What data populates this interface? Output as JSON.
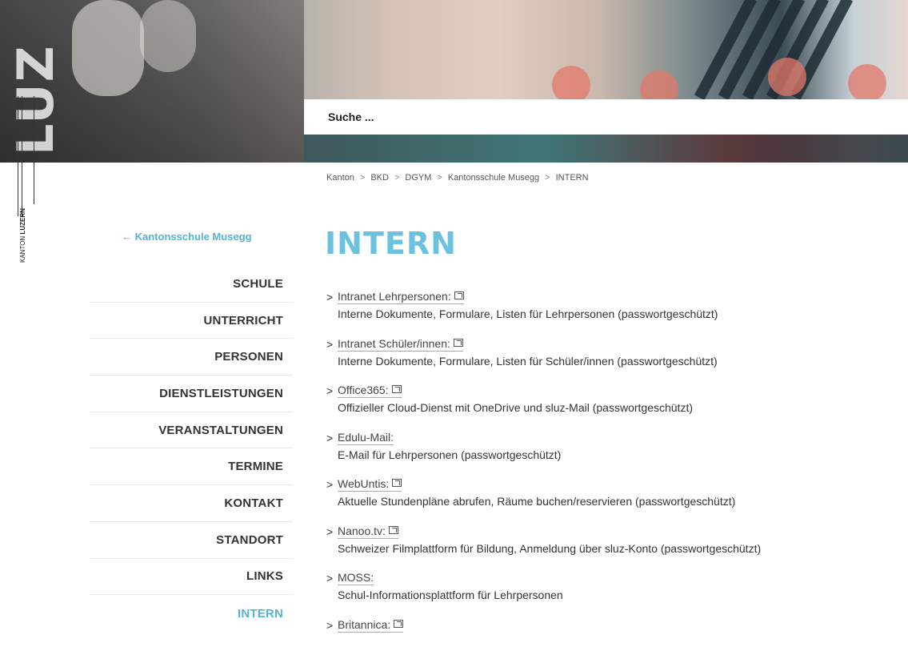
{
  "header": {
    "brand_vertical": "LUZ",
    "search_placeholder": "Suche ..."
  },
  "logo": {
    "line1": "KANTON",
    "line2": "LUZERN"
  },
  "breadcrumb": [
    "Kanton",
    "BKD",
    "DGYM",
    "Kantonsschule Musegg",
    "INTERN"
  ],
  "sidebar": {
    "back_label": "← Kantonsschule Musegg",
    "items": [
      {
        "label": "SCHULE"
      },
      {
        "label": "UNTERRICHT"
      },
      {
        "label": "PERSONEN"
      },
      {
        "label": "DIENSTLEISTUNGEN"
      },
      {
        "label": "VERANSTALTUNGEN"
      },
      {
        "label": "TERMINE"
      },
      {
        "label": "KONTAKT"
      },
      {
        "label": "STANDORT"
      },
      {
        "label": "LINKS"
      },
      {
        "label": "INTERN",
        "active": true
      }
    ]
  },
  "main": {
    "title": "INTERN",
    "links": [
      {
        "title": "Intranet Lehrpersonen:",
        "external": true,
        "desc": "Interne Dokumente, Formulare, Listen für Lehrpersonen (passwortgeschützt)"
      },
      {
        "title": "Intranet Schüler/innen:",
        "external": true,
        "desc": "Interne Dokumente, Formulare, Listen für Schüler/innen (passwortgeschützt)"
      },
      {
        "title": "Office365:",
        "external": true,
        "desc": "Offizieller Cloud-Dienst mit OneDrive und sluz-Mail (passwortgeschützt)"
      },
      {
        "title": "Edulu-Mail:",
        "external": false,
        "desc": "E-Mail für Lehrpersonen (passwortgeschützt)"
      },
      {
        "title": "WebUntis:",
        "external": true,
        "desc": "Aktuelle Stundenpläne abrufen, Räume buchen/reservieren (passwortgeschützt)"
      },
      {
        "title": "Nanoo.tv:",
        "external": true,
        "desc": "Schweizer Filmplattform für Bildung, Anmeldung über sluz-Konto (passwortgeschützt)"
      },
      {
        "title": "MOSS:",
        "external": false,
        "desc": "Schul-Informationsplattform für Lehrpersonen"
      },
      {
        "title": "Britannica:",
        "external": true,
        "desc": ""
      }
    ]
  },
  "colors": {
    "accent": "#54b3d3",
    "title": "#6cc1de"
  }
}
